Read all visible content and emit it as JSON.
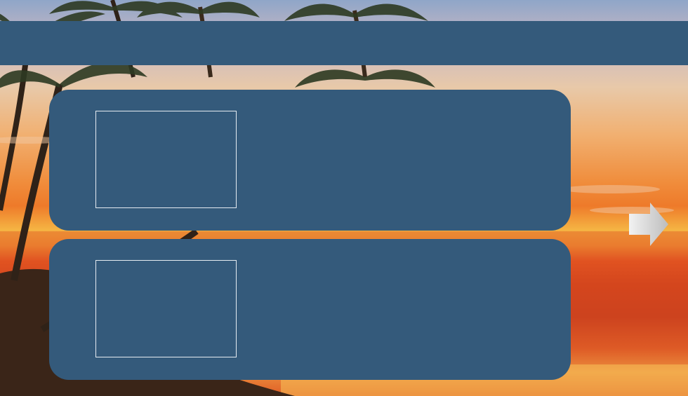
{
  "slide": {
    "title": "",
    "items": [
      {
        "text": ""
      },
      {
        "text": ""
      }
    ]
  },
  "background": {
    "scene": "tropical-sunset-palms"
  },
  "colors": {
    "panel": "#345a7b",
    "frame_border": "#e6ecf2",
    "arrow": "#d9d9d9"
  },
  "navigation": {
    "next_icon": "arrow-right-icon"
  }
}
